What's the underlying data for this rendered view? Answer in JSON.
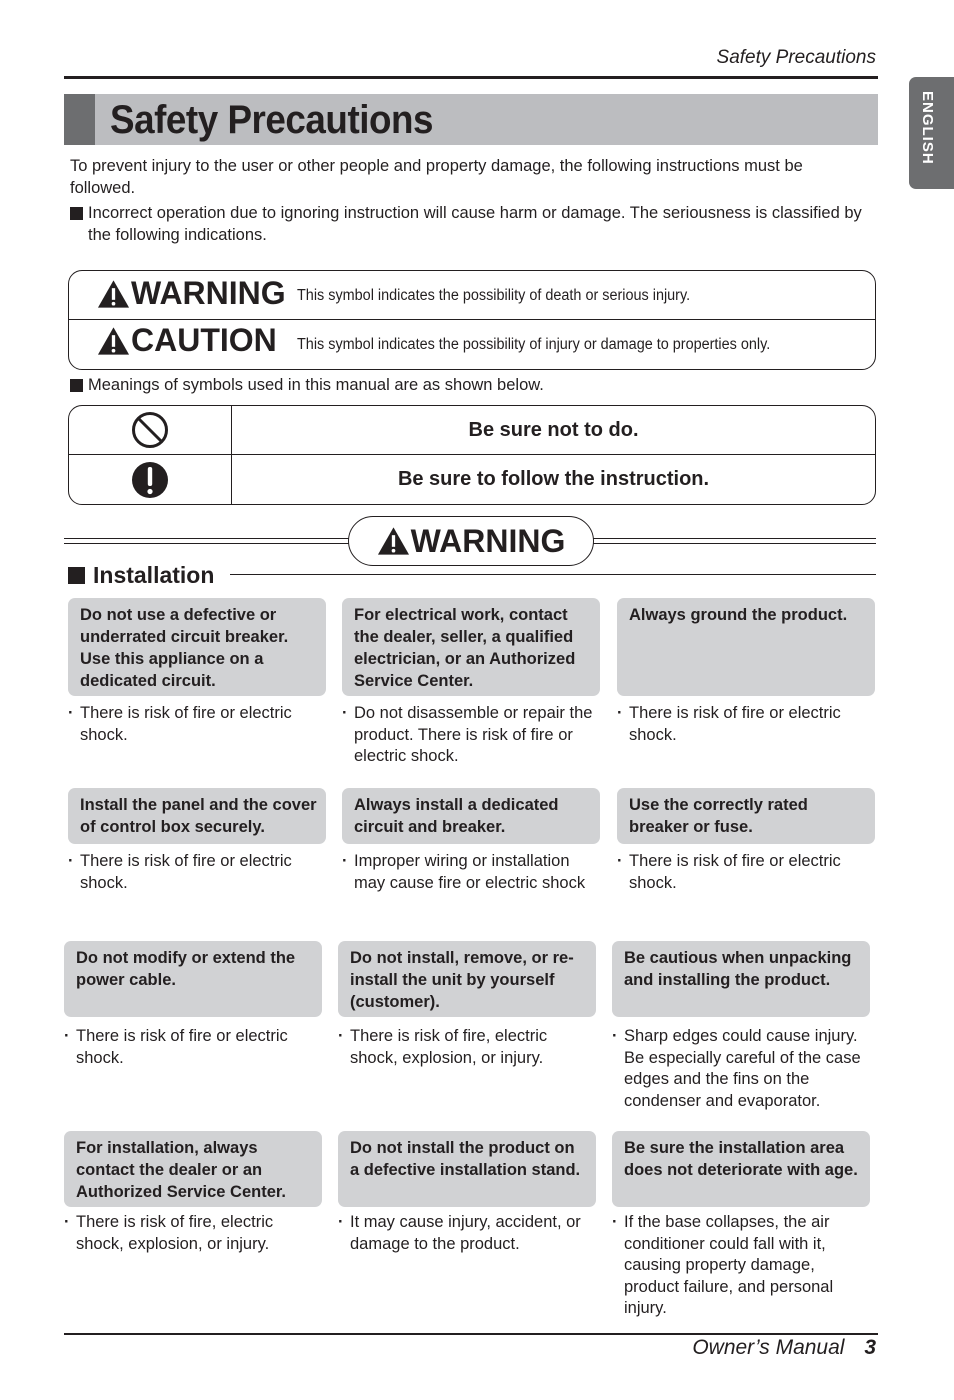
{
  "header": {
    "running_title": "Safety Precautions",
    "language_tab": "ENGLISH",
    "page_title": "Safety Precautions"
  },
  "intro": {
    "paragraph": "To prevent injury to the user or other people and property damage, the following instructions must be followed.",
    "classification_note": "Incorrect operation due to ignoring instruction will cause harm or damage. The seriousness is classified by the following indications.",
    "symbols_note": "Meanings of symbols used in this manual are as shown below."
  },
  "signal_words": [
    {
      "icon": "warning-triangle-icon",
      "word": "WARNING",
      "description": "This symbol indicates the possibility of death or serious injury."
    },
    {
      "icon": "warning-triangle-icon",
      "word": "CAUTION",
      "description": "This symbol indicates the possibility of injury or damage to properties only."
    }
  ],
  "symbols": [
    {
      "icon": "prohibition-icon",
      "meaning": "Be sure not to do."
    },
    {
      "icon": "mandatory-exclamation-icon",
      "meaning": "Be sure to follow the instruction."
    }
  ],
  "warning_banner": "WARNING",
  "section": {
    "title": "Installation",
    "items": [
      {
        "heading": "Do not use a defective or underrated circuit breaker. Use this appliance on a dedicated circuit.",
        "detail": "There is risk of fire or electric shock."
      },
      {
        "heading": "For electrical work, contact the dealer, seller, a qualified electrician, or an Authorized Service Center.",
        "detail": "Do not disassemble or repair the product. There is risk of fire or electric shock."
      },
      {
        "heading": "Always ground the product.",
        "detail": "There is risk of fire or electric shock."
      },
      {
        "heading": "Install the panel and the cover of control box securely.",
        "detail": "There is risk of fire or electric shock."
      },
      {
        "heading": "Always install a dedicated circuit and breaker.",
        "detail": "Improper wiring or installation may cause fire or electric shock"
      },
      {
        "heading": "Use the correctly rated breaker or fuse.",
        "detail": "There is risk of fire or electric shock."
      },
      {
        "heading": "Do not modify or extend the power cable.",
        "detail": "There is risk of fire or electric shock."
      },
      {
        "heading": "Do not install, remove, or re-install the unit by yourself (customer).",
        "detail": "There is risk of fire, electric shock, explosion, or injury."
      },
      {
        "heading": "Be cautious when unpacking and installing  the product.",
        "detail": "Sharp edges could cause injury. Be especially careful of the case edges and the fins on the condenser and evaporator."
      },
      {
        "heading": "For installation, always contact the dealer or an Authorized Service Center.",
        "detail": "There is risk of fire, electric shock, explosion, or injury."
      },
      {
        "heading": "Do not install the product on a defective installation stand.",
        "detail": "It may cause injury, accident, or damage to the product."
      },
      {
        "heading": "Be sure the installation area does not deteriorate with age.",
        "detail": "If the base collapses, the air conditioner could fall with it, causing property damage, product failure, and personal injury."
      }
    ]
  },
  "footer": {
    "manual_name": "Owner’s Manual",
    "page_number": "3"
  },
  "colors": {
    "title_bar": "#bcbdc0",
    "title_accent": "#6d6e70",
    "card_heading_bg": "#d1d2d4",
    "text": "#231f20"
  }
}
